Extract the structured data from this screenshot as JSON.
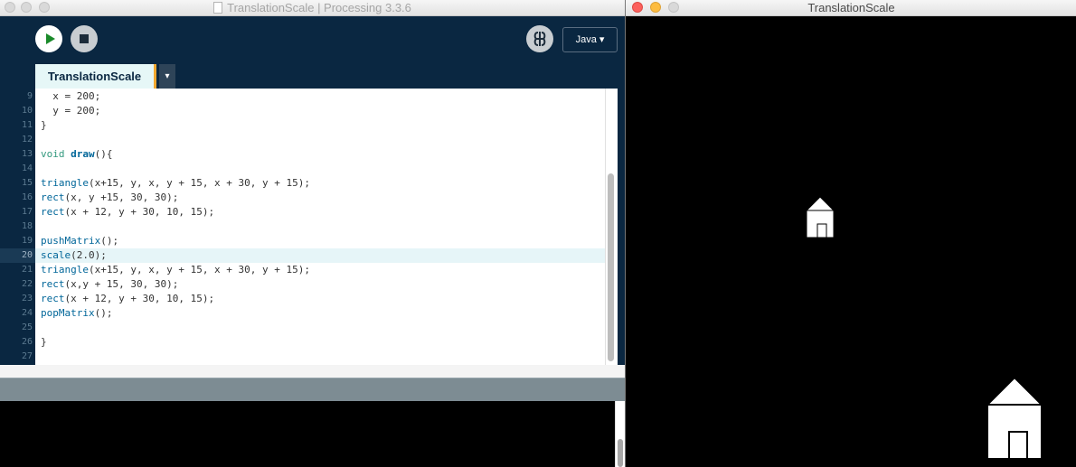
{
  "ide": {
    "window_title": "TranslationScale | Processing 3.3.6",
    "mode_label": "Java ▾",
    "tab_label": "TranslationScale",
    "tab_menu_glyph": "▾",
    "active_line_number": 20,
    "code_lines": [
      {
        "n": "9",
        "text": "  x = 200;"
      },
      {
        "n": "10",
        "text": "  y = 200;"
      },
      {
        "n": "11",
        "text": "}"
      },
      {
        "n": "12",
        "text": ""
      },
      {
        "n": "13",
        "text": "void draw(){"
      },
      {
        "n": "14",
        "text": ""
      },
      {
        "n": "15",
        "text": "triangle(x+15, y, x, y + 15, x + 30, y + 15);"
      },
      {
        "n": "16",
        "text": "rect(x, y +15, 30, 30);"
      },
      {
        "n": "17",
        "text": "rect(x + 12, y + 30, 10, 15);"
      },
      {
        "n": "18",
        "text": ""
      },
      {
        "n": "19",
        "text": "pushMatrix();"
      },
      {
        "n": "20",
        "text": "scale(2.0);"
      },
      {
        "n": "21",
        "text": "triangle(x+15, y, x, y + 15, x + 30, y + 15);"
      },
      {
        "n": "22",
        "text": "rect(x,y + 15, 30, 30);"
      },
      {
        "n": "23",
        "text": "rect(x + 12, y + 30, 10, 15);"
      },
      {
        "n": "24",
        "text": "popMatrix();"
      },
      {
        "n": "25",
        "text": ""
      },
      {
        "n": "26",
        "text": "}"
      },
      {
        "n": "27",
        "text": ""
      }
    ],
    "colors": {
      "editor_bg": "#0a2741",
      "keyword": "#33997e",
      "function": "#006699",
      "tab_accent": "#f2a82f"
    },
    "icons": [
      "run-icon",
      "stop-icon",
      "debug-icon",
      "dropdown-arrow-icon"
    ]
  },
  "sketch": {
    "window_title": "TranslationScale",
    "background_color": "#000000",
    "shape_color": "#ffffff"
  }
}
